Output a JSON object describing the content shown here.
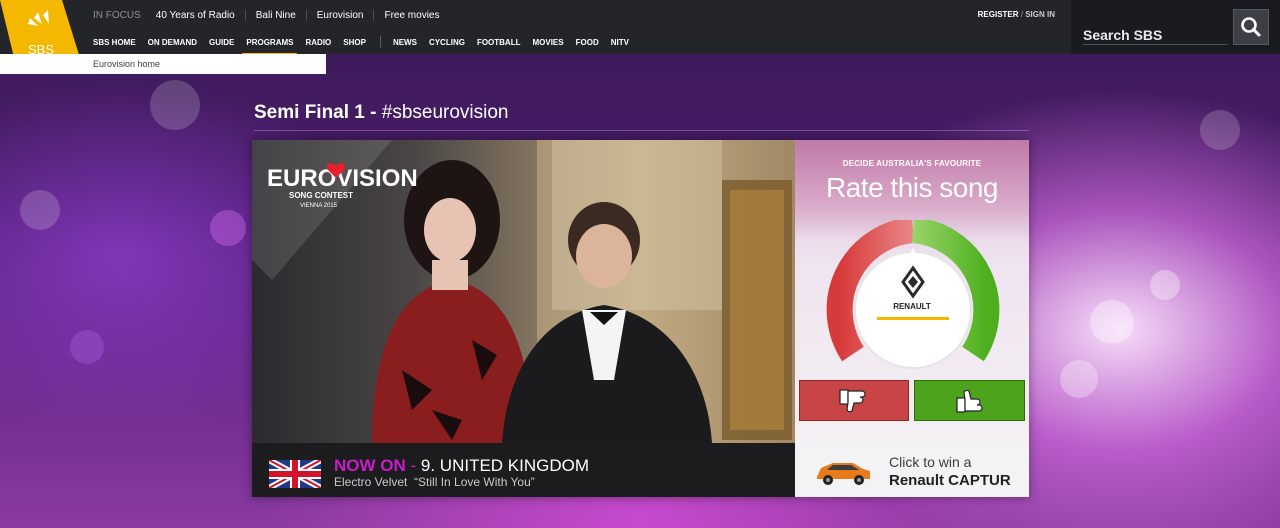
{
  "header": {
    "logo_text": "SBS",
    "in_focus_label": "IN FOCUS",
    "in_focus_links": [
      "40 Years of Radio",
      "Bali Nine",
      "Eurovision",
      "Free movies"
    ],
    "nav": [
      "SBS HOME",
      "ON DEMAND",
      "GUIDE",
      "PROGRAMS",
      "RADIO",
      "SHOP"
    ],
    "nav_secondary": [
      "NEWS",
      "CYCLING",
      "FOOTBALL",
      "MOVIES",
      "FOOD",
      "NITV"
    ],
    "active_nav": "PROGRAMS",
    "register": "REGISTER",
    "slash": " / ",
    "sign_in": "SIGN IN",
    "search_placeholder": "Search SBS"
  },
  "subnav": {
    "label": "Eurovision home"
  },
  "page": {
    "title_bold": "Semi Final 1 - ",
    "title_tag": "#sbseurovision"
  },
  "photo": {
    "logo_line1": "EUROVISION",
    "logo_line2": "SONG CONTEST",
    "logo_line3": "VIENNA 2015"
  },
  "now_playing": {
    "prefix": "NOW ON",
    "dash": " - ",
    "entry": "9. UNITED KINGDOM",
    "artist": "Electro Velvet",
    "song": "“Still In Love With You”"
  },
  "rating": {
    "kicker": "DECIDE AUSTRALIA'S FAVOURITE",
    "heading": "Rate this song",
    "sponsor": "RENAULT"
  },
  "ad": {
    "line1": "Click to win a",
    "line2": "Renault CAPTUR"
  },
  "colors": {
    "accent": "#f5b800",
    "magenta": "#c81ec8",
    "downvote": "#c94444",
    "upvote": "#4da41c"
  }
}
